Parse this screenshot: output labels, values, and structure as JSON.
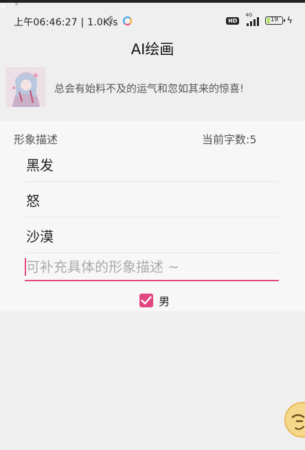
{
  "status_bar": {
    "time_speed": "上午06:46:27 | 1.0K/s",
    "hd_badge": "HD",
    "network_type": "4G",
    "battery_level": "19"
  },
  "header": {
    "title": "AI绘画"
  },
  "banner": {
    "slogan": "总会有始料不及的运气和忽如其来的惊喜!"
  },
  "form": {
    "description_label": "形象描述",
    "char_count_label": "当前字数:5",
    "tags": [
      "黑发",
      "怒",
      "沙漠"
    ],
    "input_placeholder": "可补充具体的形象描述 ~",
    "gender_option": "男",
    "gender_checked": true,
    "accent_color": "#e0467f"
  },
  "icons": {
    "moon": "moon-icon",
    "sync": "sync-icon",
    "signal": "signal-icon",
    "battery": "battery-icon",
    "charging": "charging-icon",
    "checkmark": "checkmark-icon",
    "floating": "emoji-face-icon"
  }
}
